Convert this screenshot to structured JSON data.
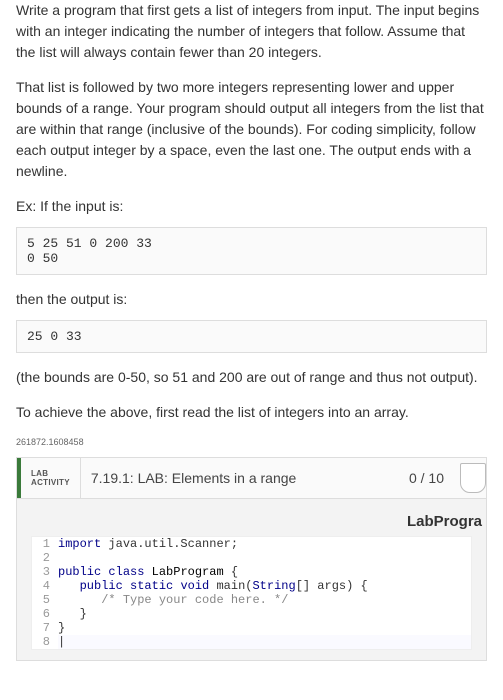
{
  "para1": "Write a program that first gets a list of integers from input. The input begins with an integer indicating the number of integers that follow. Assume that the list will always contain fewer than 20 integers.",
  "para2": "That list is followed by two more integers representing lower and upper bounds of a range. Your program should output all integers from the list that are within that range (inclusive of the bounds). For coding simplicity, follow each output integer by a space, even the last one. The output ends with a newline.",
  "ex_label": "Ex: If the input is:",
  "input_code": "5 25 51 0 200 33\n0 50",
  "then_label": "then the output is:",
  "output_code": "25 0 33",
  "para3": "(the bounds are 0-50, so 51 and 200 are out of range and thus not output).",
  "para4": "To achieve the above, first read the list of integers into an array.",
  "qid": "261872.1608458",
  "lab_badge1": "LAB",
  "lab_badge2": "ACTIVITY",
  "lab_title": "7.19.1: LAB: Elements in a range",
  "lab_score": "0 / 10",
  "file_name": "LabProgra",
  "code_lines": [
    {
      "n": "1",
      "t": "import java.util.Scanner;"
    },
    {
      "n": "2",
      "t": ""
    },
    {
      "n": "3",
      "t": "public class LabProgram {"
    },
    {
      "n": "4",
      "t": "   public static void main(String[] args) {"
    },
    {
      "n": "5",
      "t": "      /* Type your code here. */"
    },
    {
      "n": "6",
      "t": "   }"
    },
    {
      "n": "7",
      "t": "}"
    },
    {
      "n": "8",
      "t": ""
    }
  ]
}
